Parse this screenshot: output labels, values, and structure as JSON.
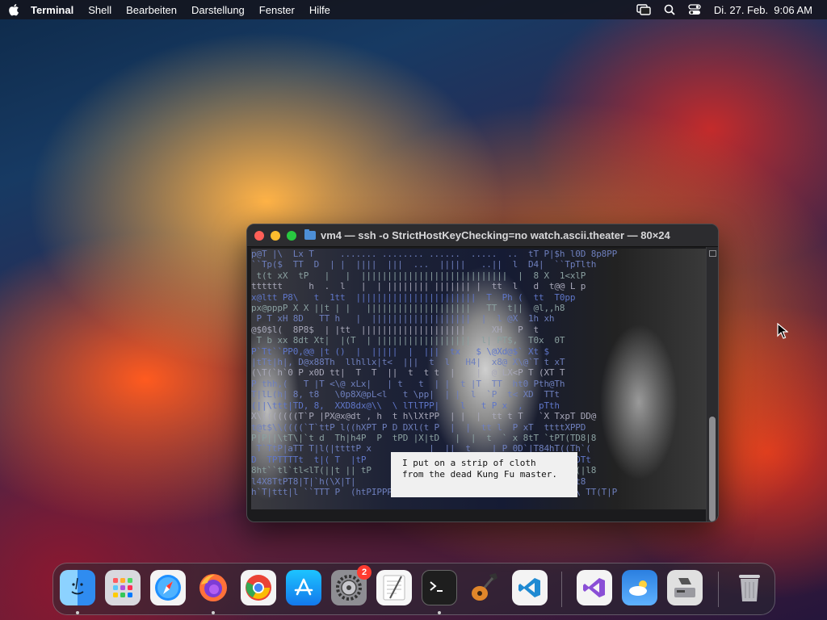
{
  "menubar": {
    "app": "Terminal",
    "items": [
      "Shell",
      "Bearbeiten",
      "Darstellung",
      "Fenster",
      "Hilfe"
    ],
    "clock": "Di. 27. Feb.  9:06 AM"
  },
  "terminal": {
    "title": "vm4 — ssh -o StrictHostKeyChecking=no watch.ascii.theater — 80×24",
    "lines": [
      "p@T |\\  Lx T     ....... ........ ......  .....  ..  tT P|$h l0D 8p8PP",
      "``Tp($  TT  D  | |  ||||  |||  ...  |||||   ..||  l  D4|  ``TpTlth",
      " t(t xX  tP   |   |  ||||||||||||||||||||||||||||  |  8 X  1<xlP",
      "tttttt     h  .  l   |  | |||||||| ||||||| |  tt  l   d  t@@ L p",
      "x@ltt P8\\   t  1tt  |||||||||||||||||||||||  T  Ph (  tt  T0pp",
      "px@pppP X X ||t | |   ||||||||||||||||||||   TT  t||  @l,,h8",
      " P T xH 8D   TT h   |  |||||||||||||||||||  |  l @X  1h xh",
      "@$0$l(  8P8$  | |tt  ||||||||||||||||||||     XH   P  t",
      " T b xx 8dt Xt|  |(T  | ||||||||||||||||||  l| PT$,  T0x  0T",
      "P`Tt``PP0,@@ |t ()  |  |||||  |  |||  tx   $ \\@Xd@$` Xt $",
      "|tTt|h|, D@x88Th  llhllx|t<  |||  t  l   H4|  x8@ X\\@`T t xT",
      "(\\T(`h`0 P x0D tt|  T  T  ||  t  t t  |    |  @`LX<P T (XT T",
      "P thh,(   T |T <\\@ xLx|   | t   t  | |  t |T  TT  ht0 Pth@Th",
      "T|lL(h| 8, t8   \\0p8X@pL<l   t \\pp|  | |  l  `P  t< XD  TTt",
      "(||\\ttt|TD, 8,  XXD8dx@\\\\  \\ lTlTPP|    l   t P x  ,   pTth",
      "X\\(((((((T`P |PX@x@dt , h  t h\\lXtPP  | |  |  tt t T   `X TxpT DD@",
      "t@t$\\\\((((`T`ttP l((hXPT P D DXl(t P  |  |  tt l  P xT  ttttXPPD",
      "P|P||\\tT\\|`t d  Th|h4P  P  tPD |X|tD   |  |  t  ` x 8tT `tPT(TD8|8",
      " T`TtP|aTT T|l(|ttttP x           |  ||  t    | P 0D`|T84hT((Th`(",
      "D  TPTTTTt  t|( T  |tP                    ||    l   D  `h\\|PT|DTt",
      "8ht``tl`tl<lT(||t || tP                   |     l     P (Phl4((|l8",
      "l4X8TtPT8|T|`h(\\X|T|                      l    |  l  xp<  8tltt8",
      "h`T|ttt|l ``TTT P  (htPIPPP t d0p0 P   ((()     ||  ll   P @ p\\ TT(T|P"
    ],
    "subtitle": [
      "I put on a strip of cloth",
      "from the dead Kung Fu master."
    ]
  },
  "dock": {
    "apps": [
      "Finder",
      "Launchpad",
      "Safari",
      "Firefox",
      "Chrome",
      "App Store",
      "Systemeinstellungen",
      "TextEdit",
      "Terminal",
      "GarageBand",
      "Visual Studio Code",
      "Visual Studio",
      "Wetter",
      "Boot Camp"
    ],
    "badge_count": "2"
  }
}
